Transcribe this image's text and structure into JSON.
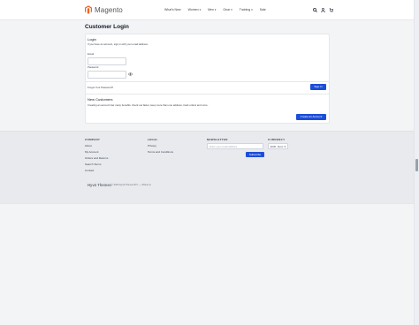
{
  "header": {
    "logo_text": "Magento",
    "nav": [
      {
        "label": "What's New",
        "has_menu": false
      },
      {
        "label": "Women",
        "has_menu": true
      },
      {
        "label": "Men",
        "has_menu": true
      },
      {
        "label": "Gear",
        "has_menu": true
      },
      {
        "label": "Training",
        "has_menu": true
      },
      {
        "label": "Sale",
        "has_menu": false
      }
    ],
    "icons": [
      "search-icon",
      "account-icon",
      "cart-icon"
    ]
  },
  "page_title": "Customer Login",
  "login": {
    "heading": "Login",
    "intro": "If you have an account, sign in with your email address.",
    "email_label": "Email",
    "email_value": "",
    "password_label": "Password",
    "password_value": "",
    "forgot_link": "Forgot Your Password?",
    "sign_in_button": "Sign In"
  },
  "new_customers": {
    "heading": "New Customers",
    "text": "Creating an account has many benefits: check out faster, keep more than one address, track orders and more.",
    "create_button": "Create an Account"
  },
  "footer": {
    "company": {
      "title": "COMPANY",
      "links": [
        "About",
        "My Account",
        "Orders and Returns",
        "Search Terms",
        "Contact"
      ]
    },
    "legal": {
      "title": "LEGAL",
      "links": [
        "Privacy",
        "Terms and Conditions"
      ]
    },
    "newsletter": {
      "title": "NEWSLETTER",
      "placeholder": "Enter your email address",
      "subscribe_button": "Subscribe"
    },
    "currency": {
      "title": "CURRENCY",
      "selected": "EUR - Euro"
    },
    "brand": "Hyvä Themes",
    "copyright": "© 2020 Hyvä Themes B.V. — Where in"
  },
  "colors": {
    "accent": "#1d4ed8",
    "page_bg": "#f3f4f6",
    "footer_bg": "#e8eaed",
    "logo_orange": "#f26322"
  }
}
